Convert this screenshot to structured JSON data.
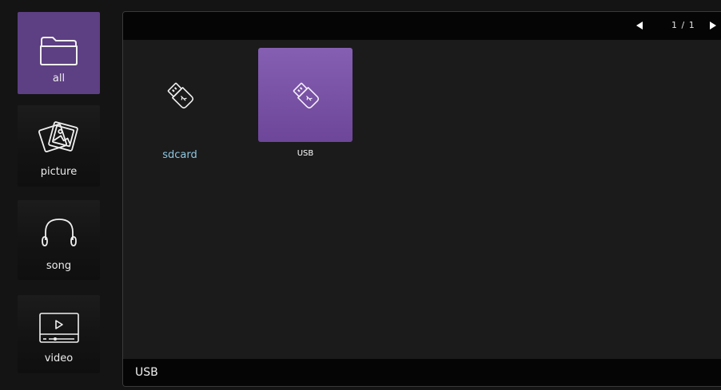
{
  "sidebar": {
    "items": [
      {
        "label": "all",
        "icon": "folder-icon",
        "active": true
      },
      {
        "label": "picture",
        "icon": "picture-icon",
        "active": false
      },
      {
        "label": "song",
        "icon": "headphones-icon",
        "active": false
      },
      {
        "label": "video",
        "icon": "video-icon",
        "active": false
      }
    ]
  },
  "header": {
    "page_indicator": "1 / 1",
    "prev_icon": "triangle-left-icon",
    "next_icon": "triangle-right-icon"
  },
  "devices": [
    {
      "label": "sdcard",
      "icon": "usb-stick-icon",
      "selected": false
    },
    {
      "label": "USB",
      "icon": "usb-stick-icon",
      "selected": true
    }
  ],
  "footer": {
    "current_path": "USB"
  },
  "colors": {
    "background": "#141414",
    "panel": "#1b1b1b",
    "bar": "#050505",
    "active_sidebar": "#5d3f83",
    "selected_tile": "#7b53a8",
    "sdcard_label": "#8fc7e0"
  }
}
